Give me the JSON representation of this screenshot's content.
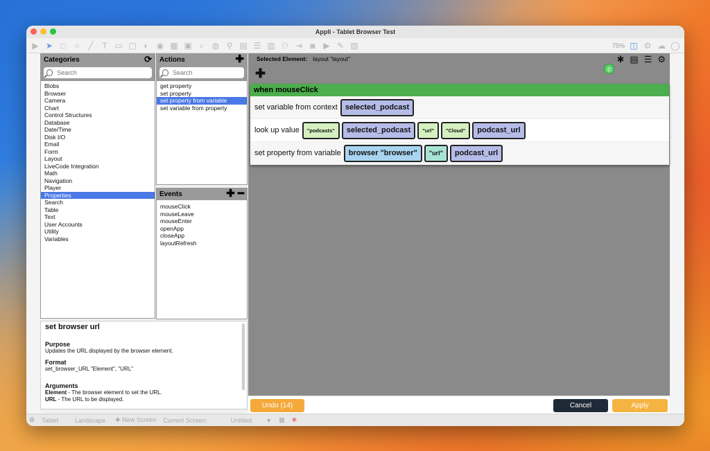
{
  "window": {
    "title": "Appli - Tablet Browser Test"
  },
  "toolbar": {
    "zoom": "75%"
  },
  "categories": {
    "title": "Categories",
    "search_placeholder": "Search",
    "items": [
      "Blobs",
      "Browser",
      "Camera",
      "Chart",
      "Control Structures",
      "Database",
      "Date/Time",
      "Disk I/O",
      "Email",
      "Form",
      "Layout",
      "LiveCode Integration",
      "Math",
      "Navigation",
      "Player",
      "Properties",
      "Search",
      "Table",
      "Text",
      "User Accounts",
      "Utility",
      "Variables"
    ],
    "selected": "Properties"
  },
  "actions": {
    "title": "Actions",
    "search_placeholder": "Search",
    "items": [
      "get property",
      "set property",
      "set property from variable",
      "set variable from property"
    ],
    "selected": "set property from variable"
  },
  "events": {
    "title": "Events",
    "items": [
      "mouseClick",
      "mouseLeave",
      "mouseEnter",
      "openApp",
      "closeApp",
      "layoutRefresh"
    ]
  },
  "doc": {
    "title": "set browser url",
    "purpose_h": "Purpose",
    "purpose": "Updates the URL displayed by the browser element.",
    "format_h": "Format",
    "format": "set_browser_URL \"Element\", \"URL\"",
    "args_h": "Arguments",
    "arg1_name": "Element",
    "arg1_desc": " - The browser element to set the URL.",
    "arg2_name": "URL",
    "arg2_desc": " - The URL to be displayed."
  },
  "editor": {
    "selected_label": "Selected Element:",
    "selected_value": "layout \"layout\"",
    "badge_count": "0",
    "block_title": "when mouseClick",
    "rows": [
      {
        "label": "set variable from context",
        "chips": [
          {
            "text": "selected_podcast",
            "kind": "var"
          }
        ]
      },
      {
        "label": "look up value",
        "chips": [
          {
            "text": "\"podcasts\"",
            "kind": "str"
          },
          {
            "text": "selected_podcast",
            "kind": "var"
          },
          {
            "text": "\"url\"",
            "kind": "str"
          },
          {
            "text": "\"Cloud\"",
            "kind": "str"
          },
          {
            "text": "podcast_url",
            "kind": "var"
          }
        ]
      },
      {
        "label": "set property from variable",
        "chips": [
          {
            "text": "browser \"browser\"",
            "kind": "el"
          },
          {
            "text": "\"url\"",
            "kind": "str2"
          },
          {
            "text": "podcast_url",
            "kind": "var"
          }
        ]
      }
    ],
    "undo_label": "Undo (14)",
    "cancel_label": "Cancel",
    "apply_label": "Apply"
  },
  "statusbar": {
    "device": "Tablet",
    "orientation": "Landscape",
    "new_screen": "New Screen",
    "current_screen_label": "Current Screen:",
    "current_screen_value": "Untitled"
  }
}
